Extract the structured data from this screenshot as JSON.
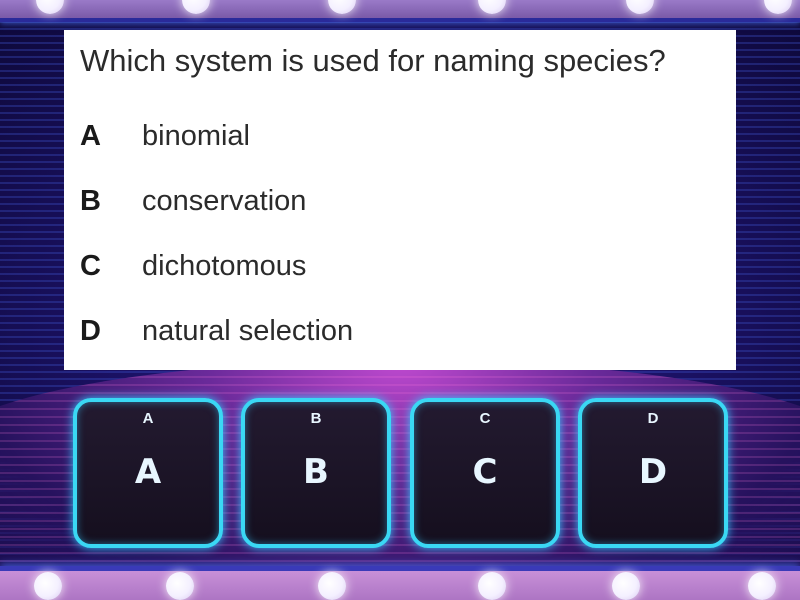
{
  "question": {
    "text": "Which system is used for naming species?",
    "options": [
      {
        "letter": "A",
        "text": "binomial"
      },
      {
        "letter": "B",
        "text": "conservation"
      },
      {
        "letter": "C",
        "text": "dichotomous"
      },
      {
        "letter": "D",
        "text": "natural selection"
      }
    ]
  },
  "answer_buttons": [
    {
      "small": "A",
      "big": "A"
    },
    {
      "small": "B",
      "big": "B"
    },
    {
      "small": "C",
      "big": "C"
    },
    {
      "small": "D",
      "big": "D"
    }
  ],
  "colors": {
    "background": "#1c1268",
    "button_border": "#3ad8f4",
    "button_fill": "#1b1426",
    "card": "#ffffff"
  }
}
